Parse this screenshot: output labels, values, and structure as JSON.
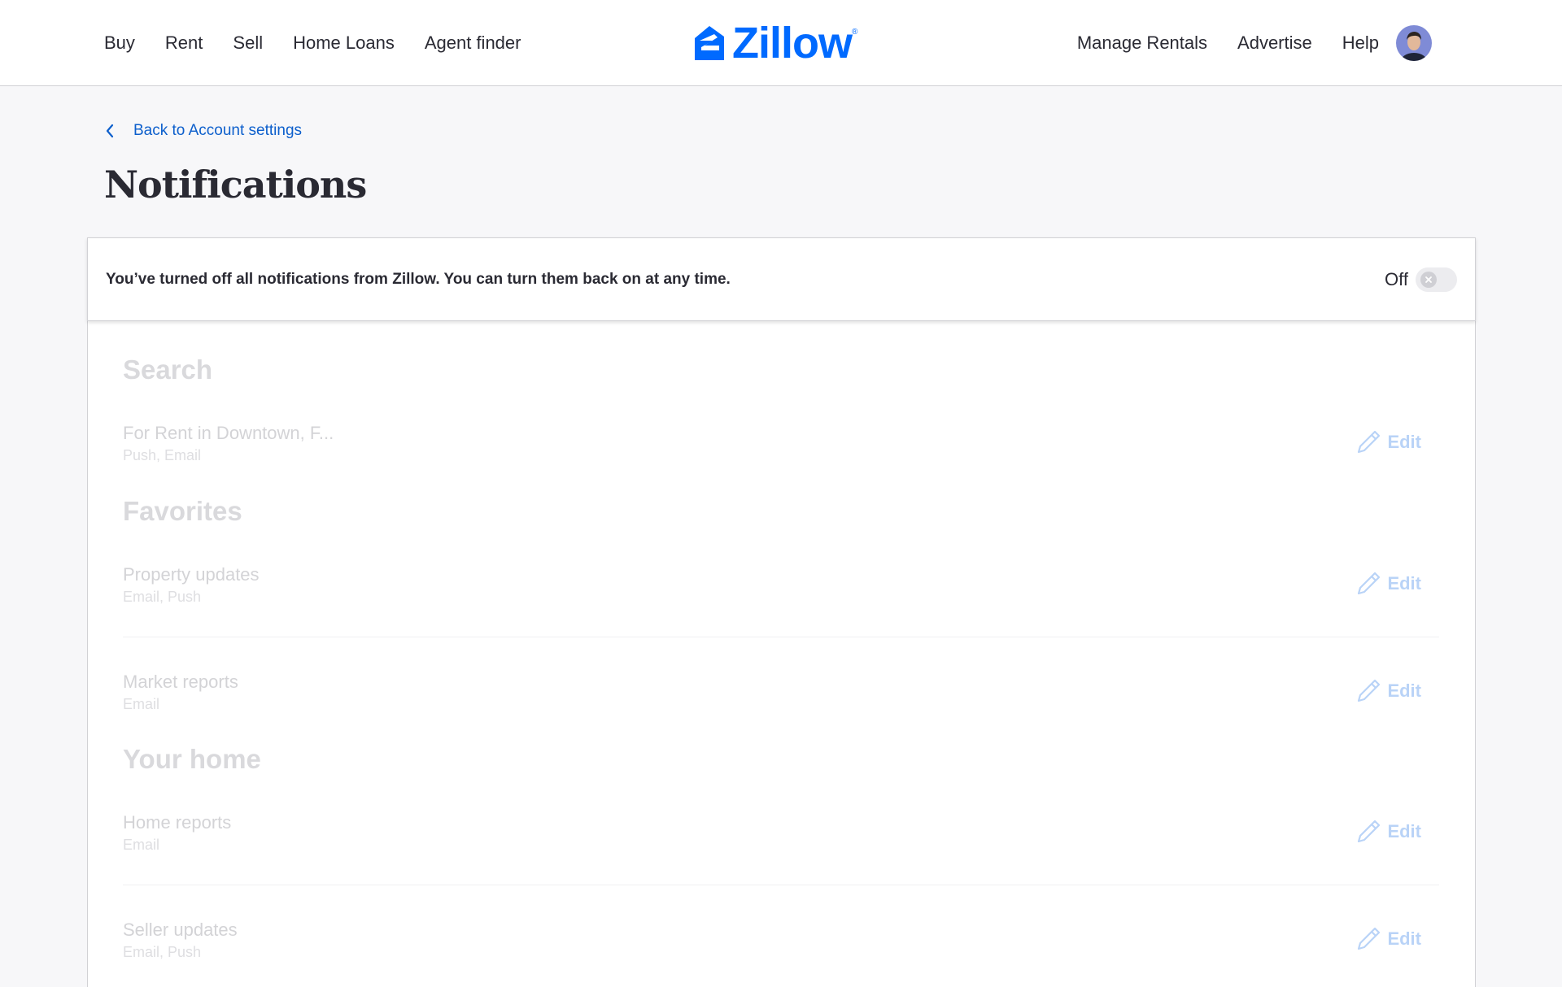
{
  "header": {
    "left_links": [
      "Buy",
      "Rent",
      "Sell",
      "Home Loans",
      "Agent finder"
    ],
    "logo_text": "Zillow",
    "logo_mark": "®",
    "right_links": [
      "Manage Rentals",
      "Advertise",
      "Help"
    ],
    "brand_color": "#006aff"
  },
  "back_link": {
    "label": "Back to Account settings",
    "icon": "chevron-left-icon"
  },
  "page_title": "Notifications",
  "banner": {
    "message": "You’ve turned off all notifications from Zillow. You can turn them back on at any time.",
    "toggle_label": "Off",
    "toggle_state": "off"
  },
  "sections": {
    "search": {
      "heading": "Search",
      "rows": [
        {
          "title": "For Rent in Downtown, F...",
          "channels": "Push, Email",
          "edit_label": "Edit"
        }
      ]
    },
    "favorites": {
      "heading": "Favorites",
      "rows": [
        {
          "title": "Property updates",
          "channels": "Email, Push",
          "edit_label": "Edit"
        },
        {
          "title": "Market reports",
          "channels": "Email",
          "edit_label": "Edit"
        }
      ]
    },
    "your_home": {
      "heading": "Your home",
      "rows": [
        {
          "title": "Home reports",
          "channels": "Email",
          "edit_label": "Edit"
        },
        {
          "title": "Seller updates",
          "channels": "Email, Push",
          "edit_label": "Edit"
        }
      ]
    }
  },
  "disabled_state": true
}
